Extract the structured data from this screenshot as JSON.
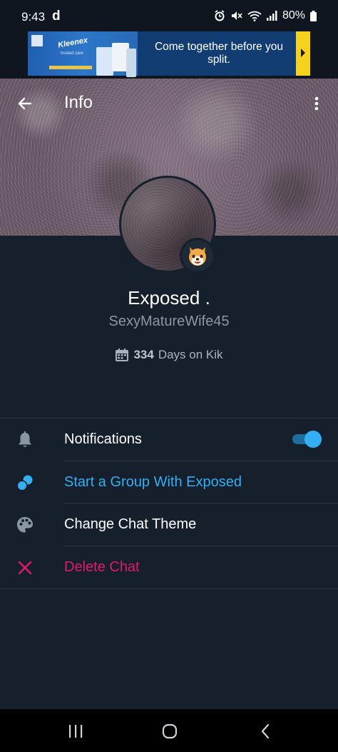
{
  "status_bar": {
    "time": "9:43",
    "carrier_glyph": "d",
    "battery": "80%"
  },
  "ad": {
    "brand": "Kleenex",
    "brand_sub": "trusted care",
    "text": "Come together before you split."
  },
  "header": {
    "title": "Info"
  },
  "profile": {
    "display_name": "Exposed .",
    "username": "SexyMatureWife45",
    "days_count": "334",
    "days_label": "Days on Kik",
    "emoji": "dog-face-emoji"
  },
  "menu": {
    "notifications": {
      "label": "Notifications",
      "enabled": true
    },
    "start_group": {
      "label": "Start a Group With Exposed"
    },
    "change_theme": {
      "label": "Change Chat Theme"
    },
    "delete_chat": {
      "label": "Delete Chat"
    }
  },
  "colors": {
    "background": "#16202d",
    "accent_blue": "#35aef2",
    "delete_pink": "#e1196f",
    "muted_text": "#8b96a4"
  },
  "icons": {
    "back": "arrow-left-icon",
    "more": "more-vertical-icon",
    "notifications": "bell-icon",
    "group": "group-bubbles-icon",
    "theme": "palette-icon",
    "delete": "close-icon",
    "days": "calendar-icon"
  }
}
